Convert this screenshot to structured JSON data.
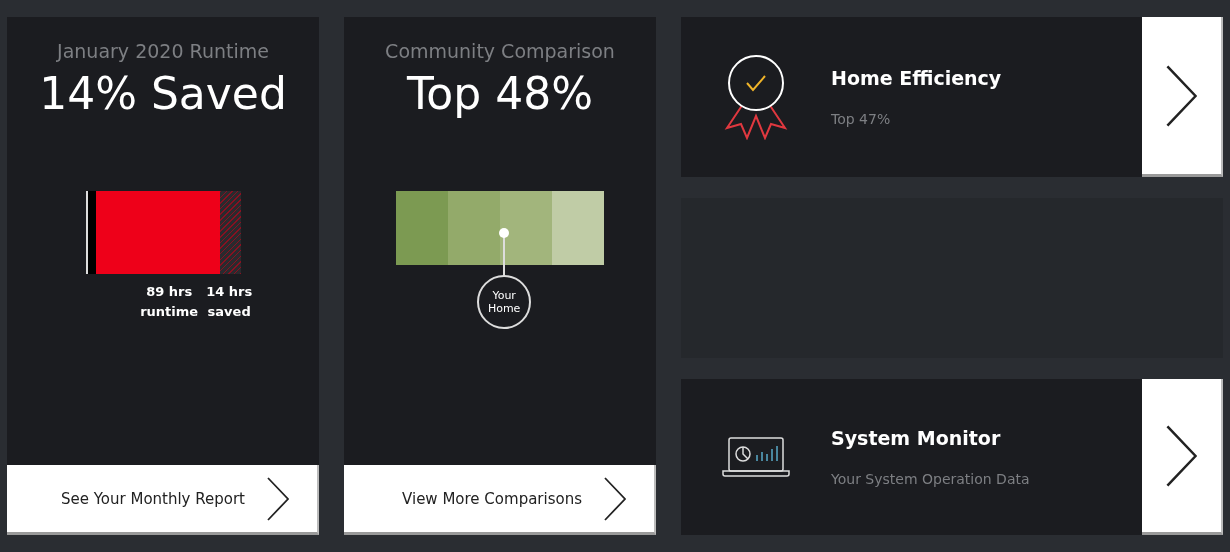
{
  "runtime_card": {
    "title": "January 2020 Runtime",
    "value": "14% Saved",
    "labels": [
      {
        "kind": "runtime",
        "amount": "89 hrs",
        "caption": "runtime"
      },
      {
        "kind": "saved",
        "amount": "14 hrs",
        "caption": "saved"
      }
    ],
    "button": "See Your Monthly Report"
  },
  "comparison_card": {
    "title": "Community Comparison",
    "value": "Top 48%",
    "segments": [
      {
        "color": "#7c9a52"
      },
      {
        "color": "#93aa6a"
      },
      {
        "color": "#a2b57c"
      },
      {
        "color": "#c0cca6"
      }
    ],
    "marker": {
      "label": "Your Home"
    },
    "button": "View More Comparisons"
  },
  "tiles": [
    {
      "kind": "efficiency",
      "title": "Home Efficiency",
      "subtitle": "Top 47%"
    },
    {
      "kind": "empty"
    },
    {
      "kind": "monitor",
      "title": "System Monitor",
      "subtitle": "Your System Operation Data"
    }
  ]
}
